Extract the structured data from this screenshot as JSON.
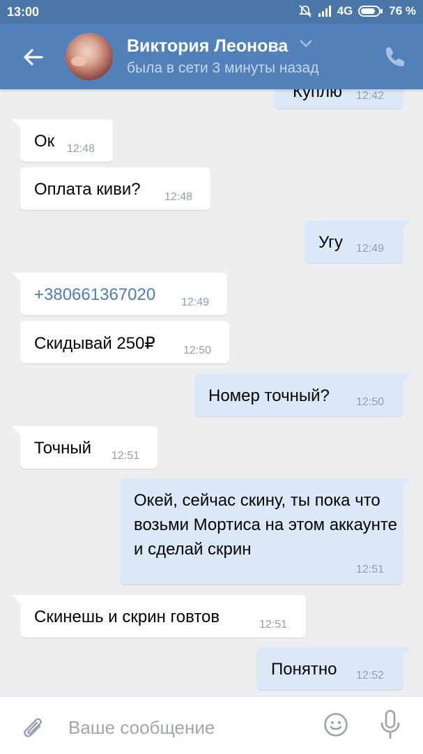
{
  "status_bar": {
    "time": "13:00",
    "network": "4G",
    "battery": "76 %",
    "icons": [
      "mute-icon",
      "signal-icon",
      "battery-icon"
    ]
  },
  "header": {
    "name": "Виктория Леонова",
    "status": "была в сети 3 минуты назад",
    "icons": [
      "back-arrow-icon",
      "chevron-down-icon",
      "phone-icon"
    ]
  },
  "messages": [
    {
      "dir": "out",
      "text": "Куплю",
      "time": "12:42"
    },
    {
      "dir": "in",
      "text": "Ок",
      "time": "12:48"
    },
    {
      "dir": "in",
      "text": "Оплата киви?",
      "time": "12:48"
    },
    {
      "dir": "out",
      "text": "Угу",
      "time": "12:49"
    },
    {
      "dir": "in",
      "text": "+380661367020",
      "time": "12:49"
    },
    {
      "dir": "in",
      "text": "Скидывай 250₽",
      "time": "12:50"
    },
    {
      "dir": "out",
      "text": "Номер точный?",
      "time": "12:50"
    },
    {
      "dir": "in",
      "text": "Точный",
      "time": "12:51"
    },
    {
      "dir": "out",
      "text": "Окей, сейчас скину, ты пока что возьми Мортиса на этом аккаунте и сделай скрин",
      "time": "12:51"
    },
    {
      "dir": "in",
      "text": "Скинешь и скрин говтов",
      "time": "12:51"
    },
    {
      "dir": "out",
      "text": "Понятно",
      "time": "12:52"
    }
  ],
  "input": {
    "placeholder": "Ваше сообщение",
    "icons": [
      "attach-icon",
      "emoji-icon",
      "mic-icon"
    ]
  },
  "colors": {
    "header": "#5181b8",
    "status_bar": "#4a76a8",
    "incoming_bubble": "#ffffff",
    "outgoing_bubble": "#dbe8f8",
    "chat_background": "#edeef0",
    "link": "#4f7db3"
  }
}
